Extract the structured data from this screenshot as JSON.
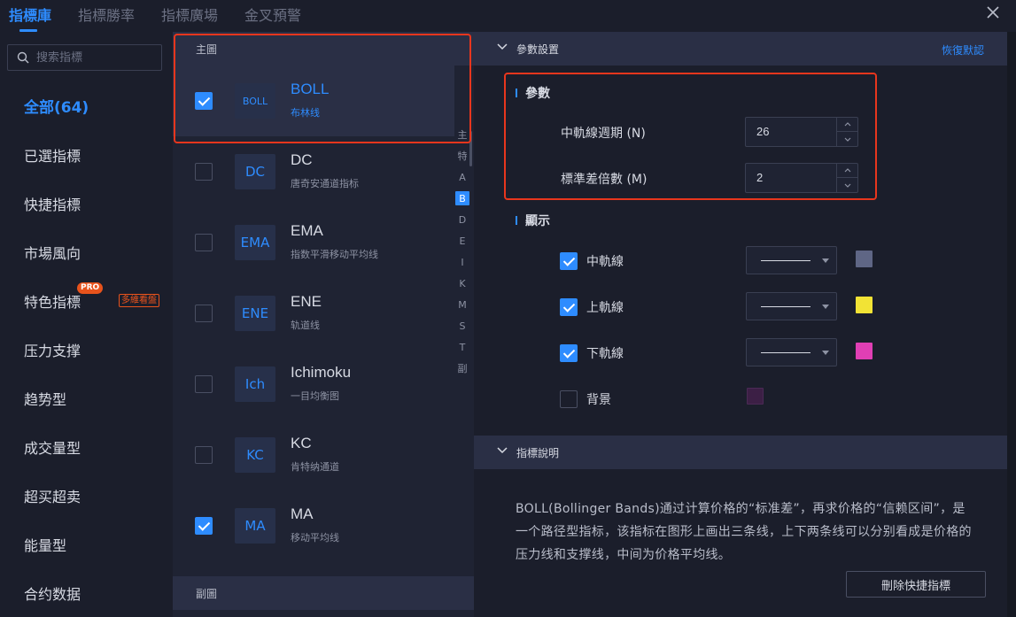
{
  "tabs": [
    {
      "label": "指標庫",
      "active": true
    },
    {
      "label": "指標勝率",
      "active": false
    },
    {
      "label": "指標廣場",
      "active": false
    },
    {
      "label": "金叉預警",
      "active": false
    }
  ],
  "search": {
    "placeholder": "搜索指標",
    "value": ""
  },
  "categories": [
    {
      "label": "全部(64)",
      "active": true
    },
    {
      "label": "已選指標"
    },
    {
      "label": "快捷指標"
    },
    {
      "label": "市場風向"
    },
    {
      "label": "特色指標",
      "badge": "PRO",
      "tag": "多維看盤"
    },
    {
      "label": "压力支撑"
    },
    {
      "label": "趋势型"
    },
    {
      "label": "成交量型"
    },
    {
      "label": "超买超卖"
    },
    {
      "label": "能量型"
    },
    {
      "label": "合约数据"
    }
  ],
  "main_section": {
    "title": "主圖"
  },
  "sub_section": {
    "title": "副圖"
  },
  "indicators": [
    {
      "code": "BOLL",
      "name": "BOLL",
      "desc": "布林线",
      "checked": true,
      "selected": true
    },
    {
      "code": "DC",
      "name": "DC",
      "desc": "唐奇安通道指标",
      "checked": false
    },
    {
      "code": "EMA",
      "name": "EMA",
      "desc": "指数平滑移动平均线",
      "checked": false
    },
    {
      "code": "ENE",
      "name": "ENE",
      "desc": "轨道线",
      "checked": false
    },
    {
      "code": "Ich",
      "name": "Ichimoku",
      "desc": "一目均衡图",
      "checked": false
    },
    {
      "code": "KC",
      "name": "KC",
      "desc": "肯特纳通道",
      "checked": false
    },
    {
      "code": "MA",
      "name": "MA",
      "desc": "移动平均线",
      "checked": true
    }
  ],
  "alpha_index": [
    "主",
    "特",
    "A",
    "B",
    "D",
    "E",
    "I",
    "K",
    "M",
    "S",
    "T",
    "副"
  ],
  "alpha_active": "B",
  "settings": {
    "section_title": "參數設置",
    "reset_label": "恢復默認",
    "params_title": "參數",
    "params": [
      {
        "label": "中軌線週期 (N)",
        "value": "26"
      },
      {
        "label": "標準差倍數 (M)",
        "value": "2"
      }
    ],
    "display_title": "顯示",
    "display": [
      {
        "label": "中軌線",
        "checked": true,
        "color": "#5f6685",
        "has_line": true
      },
      {
        "label": "上軌線",
        "checked": true,
        "color": "#f2e335",
        "has_line": true
      },
      {
        "label": "下軌線",
        "checked": true,
        "color": "#e03fb4",
        "has_line": true
      },
      {
        "label": "背景",
        "checked": false,
        "color": "#3c1f45",
        "has_line": false
      }
    ]
  },
  "description": {
    "section_title": "指標說明",
    "text": "BOLL(Bollinger Bands)通过计算价格的“标准差”，再求价格的“信赖区间”，是一个路径型指标，该指标在图形上画出三条线，上下两条线可以分别看成是价格的压力线和支撑线，中间为价格平均线。"
  },
  "delete_button": "刪除快捷指標",
  "colors": {
    "accent": "#2e8cff",
    "highlight_frame": "#e8361d",
    "pro_badge": "#e8531c"
  }
}
